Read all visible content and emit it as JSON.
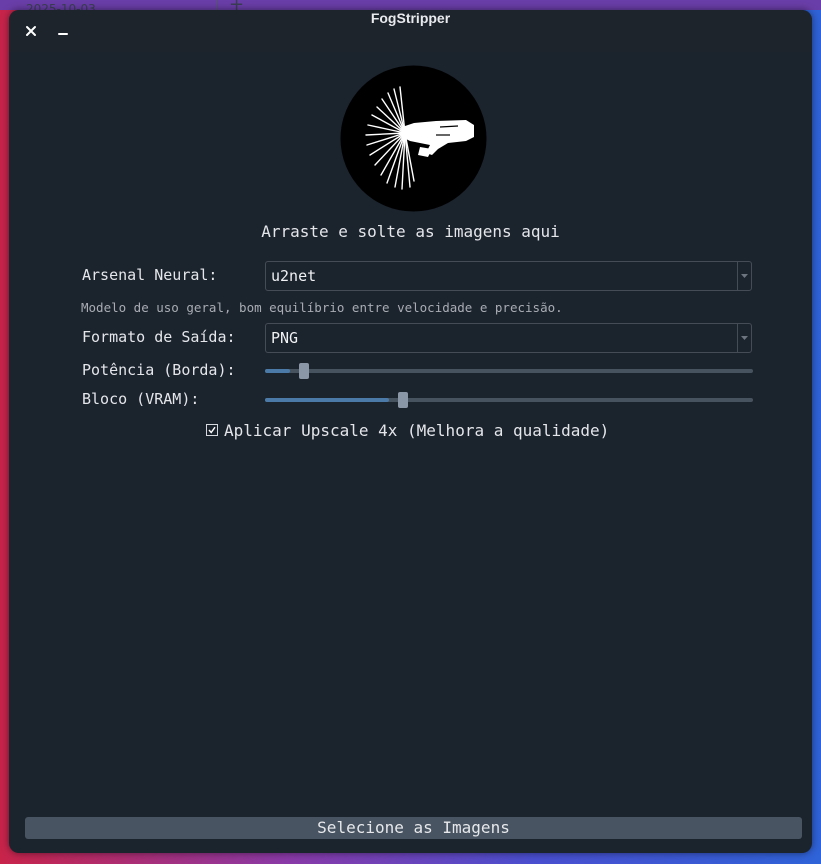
{
  "background": {
    "date_text": "2025-10-03",
    "plus_label": "+"
  },
  "window": {
    "title": "FogStripper",
    "close_icon": "close-icon",
    "minimize_icon": "minimize-icon"
  },
  "logo": {
    "icon": "fog-spray-hand-logo"
  },
  "drop_zone": {
    "text": "Arraste e solte as imagens aqui"
  },
  "form": {
    "model": {
      "label": "Arsenal Neural:",
      "value": "u2net",
      "description": "Modelo de uso geral, bom equilíbrio entre velocidade e precisão."
    },
    "format": {
      "label": "Formato de Saída:",
      "value": "PNG"
    },
    "edge_power": {
      "label": "Potência (Borda):",
      "level": 0.04
    },
    "vram_block": {
      "label": "Bloco (VRAM):",
      "level": 0.244
    },
    "upscale": {
      "label": "Aplicar Upscale 4x (Melhora a qualidade)",
      "checked": true
    }
  },
  "footer": {
    "select_button_label": "Selecione as Imagens"
  },
  "colors": {
    "window_bg": "#1b232d",
    "slider_fill": "#4b7aa8",
    "button_bg": "#485461"
  }
}
